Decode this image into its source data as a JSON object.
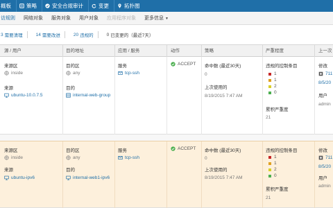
{
  "topnav": {
    "items": [
      {
        "label": "概板",
        "icon": "dashboard-icon"
      },
      {
        "label": "策略",
        "icon": "policy-icon"
      },
      {
        "label": "安全合规审计",
        "icon": "check-circle-icon"
      },
      {
        "label": "变更",
        "icon": "refresh-icon"
      },
      {
        "label": "拓扑图",
        "icon": "map-pin-icon"
      }
    ]
  },
  "subnav": {
    "tabs": [
      {
        "label": "访规则",
        "state": "active"
      },
      {
        "label": "网络对象",
        "state": "normal"
      },
      {
        "label": "服务对象",
        "state": "normal"
      },
      {
        "label": "用户对象",
        "state": "normal"
      },
      {
        "label": "应用程序对象",
        "state": "disabled"
      },
      {
        "label": "更多信息",
        "state": "normal",
        "caret": "▼"
      }
    ]
  },
  "filters": [
    {
      "count": "3",
      "label": "需要清理",
      "style": "blue"
    },
    {
      "count": "14",
      "label": "需要改进",
      "style": "blue"
    },
    {
      "count": "20",
      "label": "违规的",
      "style": "blue"
    },
    {
      "count": "0",
      "label": "已变更的（最近7天）",
      "style": "grey"
    }
  ],
  "table": {
    "headers": [
      "源 / 用户",
      "目的地址",
      "应用 / 服务",
      "动作",
      "策略",
      "严重程度",
      "上一次修"
    ],
    "rows": [
      {
        "source_zone_label": "来源区",
        "source_zone": "inside",
        "source_label": "来源",
        "source": "ubuntu-10.0.7.5",
        "dest_zone_label": "目的区",
        "dest_zone": "any",
        "dest_label": "目的",
        "dest": "internal-web-group",
        "service_label": "服务",
        "service": "tcp-ssh",
        "action": "ACCEPT",
        "hits_label": "命中数 (最近30天)",
        "hits": "0",
        "last_used_label": "上次使用的",
        "last_used": "8/19/2015 7:47 AM",
        "violated_label": "违规的控制条目",
        "violations": [
          {
            "color": "#c62828",
            "count": "1"
          },
          {
            "color": "#e0a020",
            "count": "1"
          },
          {
            "color": "#d9cf2a",
            "count": "2"
          },
          {
            "color": "#4caf50",
            "count": "0"
          }
        ],
        "cumulative_label": "累积严重度",
        "cumulative": "21",
        "mod_label": "修改",
        "mod_id": "711",
        "mod_date": "8/5/20",
        "user_label": "用户",
        "user": "admin"
      },
      {
        "source_zone_label": "来源区",
        "source_zone": "inside",
        "source_label": "来源",
        "source": "ubuntu-ipv6",
        "dest_zone_label": "目的区",
        "dest_zone": "any",
        "dest_label": "目的",
        "dest": "internal-web1-ipv6",
        "service_label": "服务",
        "service": "tcp-ssh",
        "action": "ACCEPT",
        "hits_label": "命中数 (最近30天)",
        "hits": "0",
        "last_used_label": "上次使用的",
        "last_used": "8/19/2015 7:47 AM",
        "violated_label": "违规的控制条目",
        "violations": [
          {
            "color": "#c62828",
            "count": "1"
          },
          {
            "color": "#e0a020",
            "count": "1"
          },
          {
            "color": "#d9cf2a",
            "count": "2"
          },
          {
            "color": "#4caf50",
            "count": "0"
          }
        ],
        "cumulative_label": "累积严重度",
        "cumulative": "21",
        "mod_label": "修改",
        "mod_id": "711",
        "mod_date": "8/5/20",
        "user_label": "用户",
        "user": "admin"
      }
    ]
  },
  "colors": {
    "topnav_bg": "#1f6fa8",
    "link": "#1f6fa8",
    "accept": "#4caf50",
    "highlight_row": "#fdf0dc"
  }
}
